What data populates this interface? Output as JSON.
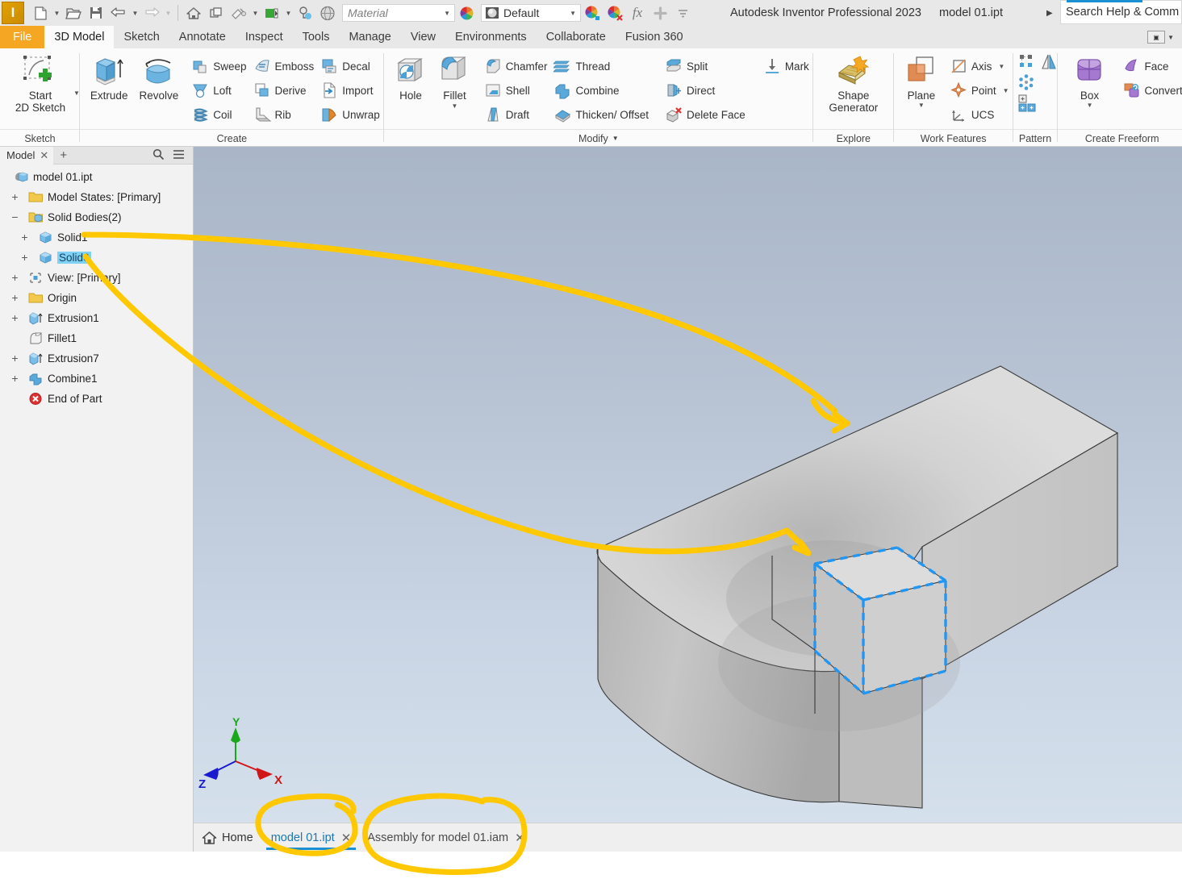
{
  "titlebar": {
    "app_initial": "I",
    "app_name": "Autodesk Inventor Professional 2023",
    "document_name": "model 01.ipt",
    "material_placeholder": "Material",
    "appearance_value": "Default",
    "search_placeholder": "Search Help & Comm",
    "quick_access": [
      {
        "name": "new-icon",
        "label": "New"
      },
      {
        "name": "open-icon",
        "label": "Open"
      },
      {
        "name": "save-icon",
        "label": "Save"
      },
      {
        "name": "undo-icon",
        "label": "Undo"
      },
      {
        "name": "redo-icon",
        "label": "Redo"
      },
      {
        "name": "home-icon",
        "label": "Home"
      },
      {
        "name": "project-icon",
        "label": "Projects"
      },
      {
        "name": "appearance-icon",
        "label": "Appearance"
      },
      {
        "name": "updates-icon",
        "label": "Update"
      },
      {
        "name": "material-sphere-icon",
        "label": "Material Browser"
      }
    ],
    "accent_color": "#1a8fd4",
    "file_tab_color": "#f5a623"
  },
  "ribbon_tabs": [
    {
      "label": "File",
      "active": false,
      "kind": "file"
    },
    {
      "label": "3D Model",
      "active": true,
      "kind": "normal"
    },
    {
      "label": "Sketch",
      "active": false,
      "kind": "normal"
    },
    {
      "label": "Annotate",
      "active": false,
      "kind": "normal"
    },
    {
      "label": "Inspect",
      "active": false,
      "kind": "normal"
    },
    {
      "label": "Tools",
      "active": false,
      "kind": "normal"
    },
    {
      "label": "Manage",
      "active": false,
      "kind": "normal"
    },
    {
      "label": "View",
      "active": false,
      "kind": "normal"
    },
    {
      "label": "Environments",
      "active": false,
      "kind": "normal"
    },
    {
      "label": "Collaborate",
      "active": false,
      "kind": "normal"
    },
    {
      "label": "Fusion 360",
      "active": false,
      "kind": "normal"
    }
  ],
  "ribbon": {
    "groups": [
      {
        "label": "Sketch",
        "big": [
          {
            "label": "Start\n2D Sketch",
            "icon": "start-2d-sketch-icon",
            "dropdown": true
          }
        ],
        "cols": []
      },
      {
        "label": "Create",
        "big": [
          {
            "label": "Extrude",
            "icon": "extrude-icon",
            "dropdown": false
          },
          {
            "label": "Revolve",
            "icon": "revolve-icon",
            "dropdown": false
          }
        ],
        "cols": [
          [
            {
              "label": "Sweep",
              "icon": "sweep-icon"
            },
            {
              "label": "Loft",
              "icon": "loft-icon"
            },
            {
              "label": "Coil",
              "icon": "coil-icon"
            }
          ],
          [
            {
              "label": "Emboss",
              "icon": "emboss-icon"
            },
            {
              "label": "Derive",
              "icon": "derive-icon"
            },
            {
              "label": "Rib",
              "icon": "rib-icon"
            }
          ],
          [
            {
              "label": "Decal",
              "icon": "decal-icon"
            },
            {
              "label": "Import",
              "icon": "import-icon"
            },
            {
              "label": "Unwrap",
              "icon": "unwrap-icon"
            }
          ]
        ]
      },
      {
        "label": "Modify",
        "label_dropdown": true,
        "big": [
          {
            "label": "Hole",
            "icon": "hole-icon",
            "dropdown": false
          },
          {
            "label": "Fillet",
            "icon": "fillet-icon",
            "dropdown": true
          }
        ],
        "cols": [
          [
            {
              "label": "Chamfer",
              "icon": "chamfer-icon"
            },
            {
              "label": "Shell",
              "icon": "shell-icon"
            },
            {
              "label": "Draft",
              "icon": "draft-icon"
            }
          ],
          [
            {
              "label": "Thread",
              "icon": "thread-icon"
            },
            {
              "label": "Combine",
              "icon": "combine-icon"
            },
            {
              "label": "Thicken/ Offset",
              "icon": "thicken-offset-icon"
            }
          ],
          [
            {
              "label": "Split",
              "icon": "split-icon"
            },
            {
              "label": "Direct",
              "icon": "direct-icon"
            },
            {
              "label": "Delete Face",
              "icon": "delete-face-icon"
            }
          ],
          [
            {
              "label": "Mark",
              "icon": "mark-icon"
            }
          ]
        ]
      },
      {
        "label": "Explore",
        "big": [
          {
            "label": "Shape\nGenerator",
            "icon": "shape-generator-icon",
            "dropdown": false
          }
        ],
        "cols": []
      },
      {
        "label": "Work Features",
        "big": [
          {
            "label": "Plane",
            "icon": "plane-icon",
            "dropdown": true
          }
        ],
        "cols": [
          [
            {
              "label": "Axis",
              "icon": "axis-icon",
              "dropdown": true
            },
            {
              "label": "Point",
              "icon": "point-icon",
              "dropdown": true
            },
            {
              "label": "UCS",
              "icon": "ucs-icon"
            }
          ]
        ]
      },
      {
        "label": "Pattern",
        "icon_only": [
          {
            "name": "rectangular-pattern-icon"
          },
          {
            "name": "mirror-icon"
          },
          {
            "name": "circular-pattern-icon"
          },
          {
            "name": "sketch-driven-pattern-icon"
          }
        ]
      },
      {
        "label": "Create Freeform",
        "big": [
          {
            "label": "Box",
            "icon": "freeform-box-icon",
            "dropdown": true
          }
        ],
        "cols": [
          [
            {
              "label": "Face",
              "icon": "freeform-face-icon"
            },
            {
              "label": "Convert",
              "icon": "freeform-convert-icon"
            }
          ]
        ]
      }
    ]
  },
  "browser": {
    "tab_label": "Model",
    "close_glyph": "✕",
    "add_glyph": "+",
    "search_icon": "search-icon",
    "menu_icon": "hamburger-menu-icon",
    "tree": [
      {
        "label": "model 01.ipt",
        "indent": 0,
        "expander": "",
        "icon": "part-icon",
        "selected": false
      },
      {
        "label": "Model States: [Primary]",
        "indent": 1,
        "expander": "+",
        "icon": "folder-icon",
        "selected": false
      },
      {
        "label": "Solid Bodies(2)",
        "indent": 1,
        "expander": "−",
        "icon": "folder-solids-icon",
        "selected": false
      },
      {
        "label": "Solid1",
        "indent": 2,
        "expander": "+",
        "icon": "solid-body-icon",
        "selected": false
      },
      {
        "label": "Solid6",
        "indent": 2,
        "expander": "+",
        "icon": "solid-body-icon",
        "selected": true
      },
      {
        "label": "View: [Primary]",
        "indent": 1,
        "expander": "+",
        "icon": "view-icon",
        "selected": false
      },
      {
        "label": "Origin",
        "indent": 1,
        "expander": "+",
        "icon": "folder-icon",
        "selected": false
      },
      {
        "label": "Extrusion1",
        "indent": 1,
        "expander": "+",
        "icon": "extrusion-icon",
        "selected": false
      },
      {
        "label": "Fillet1",
        "indent": 1,
        "expander": "",
        "icon": "fillet-feature-icon",
        "selected": false
      },
      {
        "label": "Extrusion7",
        "indent": 1,
        "expander": "+",
        "icon": "extrusion-icon",
        "selected": false
      },
      {
        "label": "Combine1",
        "indent": 1,
        "expander": "+",
        "icon": "combine-feature-icon",
        "selected": false
      },
      {
        "label": "End of Part",
        "indent": 1,
        "expander": "",
        "icon": "end-of-part-icon",
        "selected": false
      }
    ]
  },
  "viewport": {
    "axis_indicator": {
      "x_label": "X",
      "y_label": "Y",
      "z_label": "Z",
      "x_color": "#d01717",
      "y_color": "#1aa81a",
      "z_color": "#1a1ad0"
    },
    "selection_color": "#2196f3",
    "annotation_color": "#ffc800",
    "body_color": "#d6d6d6"
  },
  "doctabs": {
    "home_label": "Home",
    "home_icon": "home-icon",
    "tabs": [
      {
        "label": "model 01.ipt",
        "active": true,
        "close": "✕"
      },
      {
        "label": "Assembly for model 01.iam",
        "active": false,
        "close": "✕"
      }
    ]
  }
}
